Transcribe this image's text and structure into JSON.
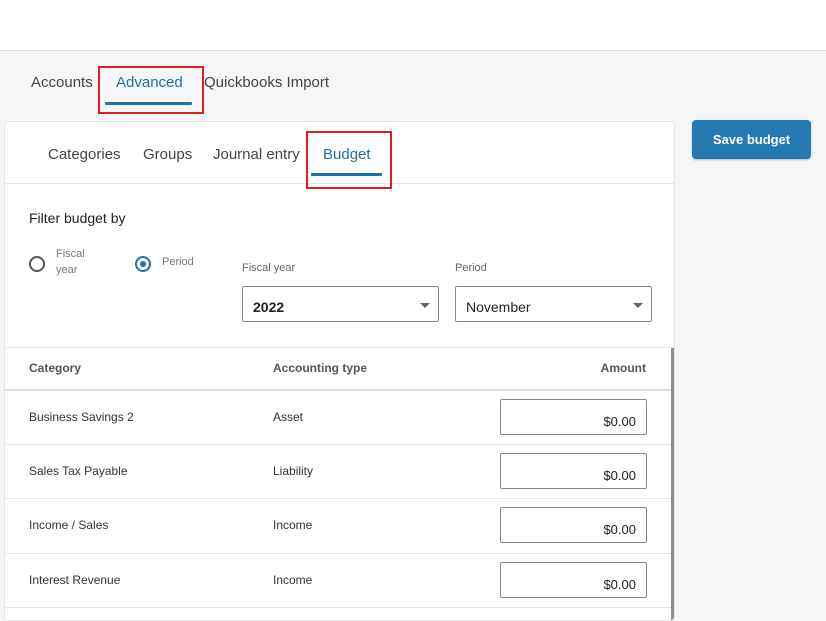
{
  "main_tabs": [
    {
      "label": "Accounts",
      "active": false
    },
    {
      "label": "Advanced",
      "active": true
    },
    {
      "label": "Quickbooks Import",
      "active": false
    }
  ],
  "sub_tabs": [
    {
      "label": "Categories",
      "active": false
    },
    {
      "label": "Groups",
      "active": false
    },
    {
      "label": "Journal entry",
      "active": false
    },
    {
      "label": "Budget",
      "active": true
    }
  ],
  "actions": {
    "save_label": "Save budget"
  },
  "filter": {
    "title": "Filter budget by",
    "options": [
      {
        "label_line1": "Fiscal",
        "label_line2": "year",
        "checked": false
      },
      {
        "label": "Period",
        "checked": true
      }
    ],
    "fiscal_year": {
      "label": "Fiscal year",
      "value": "2022"
    },
    "period": {
      "label": "Period",
      "value": "November"
    }
  },
  "table": {
    "headers": {
      "category": "Category",
      "accounting_type": "Accounting type",
      "amount": "Amount"
    },
    "rows": [
      {
        "category": "Business Savings 2",
        "type": "Asset",
        "amount": "$0.00"
      },
      {
        "category": "Sales Tax Payable",
        "type": "Liability",
        "amount": "$0.00"
      },
      {
        "category": "Income / Sales",
        "type": "Income",
        "amount": "$0.00"
      },
      {
        "category": "Interest Revenue",
        "type": "Income",
        "amount": "$0.00"
      }
    ]
  },
  "colors": {
    "accent": "#1f6fa8",
    "button": "#2479b3",
    "highlight": "#e01e1e"
  }
}
